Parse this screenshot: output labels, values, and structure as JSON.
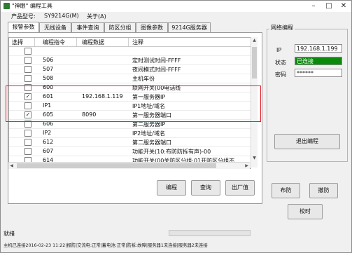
{
  "window": {
    "title": "\"神眼\" 编程工具",
    "min_icon": "minimize-icon",
    "max_icon": "maximize-icon",
    "close_icon": "close-icon"
  },
  "menu": {
    "product_label": "产品型号:",
    "product_model": "SY9214G(M)",
    "about": "关于(A)"
  },
  "tabs": [
    {
      "label": "报警参数",
      "active": true
    },
    {
      "label": "无线设备",
      "active": false
    },
    {
      "label": "事件查询",
      "active": false
    },
    {
      "label": "防区分组",
      "active": false
    },
    {
      "label": "图像参数",
      "active": false
    },
    {
      "label": "9214G服务器",
      "active": false
    }
  ],
  "table": {
    "headers": [
      "选择",
      "编程指令",
      "编程数据",
      "注释"
    ],
    "rows": [
      {
        "checked": false,
        "cmd": "",
        "data": "",
        "note": ""
      },
      {
        "checked": false,
        "cmd": "506",
        "data": "",
        "note": "定时测试时间-FFFF"
      },
      {
        "checked": false,
        "cmd": "507",
        "data": "",
        "note": "夜间模式时间-FFFF"
      },
      {
        "checked": false,
        "cmd": "508",
        "data": "",
        "note": "主机年份"
      },
      {
        "checked": false,
        "cmd": "600",
        "data": "",
        "note": "联网开关(00电话线"
      },
      {
        "checked": true,
        "cmd": "601",
        "data": "192.168.1.119",
        "note": "第一服务器IP"
      },
      {
        "checked": false,
        "cmd": "IP1",
        "data": "",
        "note": "IP1地址/域名"
      },
      {
        "checked": true,
        "cmd": "605",
        "data": "8090",
        "note": "第一服务器端口"
      },
      {
        "checked": false,
        "cmd": "606",
        "data": "",
        "note": "第二服务器IP"
      },
      {
        "checked": false,
        "cmd": "IP2",
        "data": "",
        "note": "IP2地址/域名"
      },
      {
        "checked": false,
        "cmd": "612",
        "data": "",
        "note": "第二服务器端口"
      },
      {
        "checked": false,
        "cmd": "607",
        "data": "",
        "note": "功能开关(10:布防防拆有声)-00"
      },
      {
        "checked": false,
        "cmd": "614",
        "data": "",
        "note": "功能开关(00关防区分组;01开防区分组不"
      }
    ]
  },
  "buttons": {
    "program": "编程",
    "query": "查询",
    "factory": "出厂值",
    "exit_program": "退出编程",
    "arm": "布防",
    "disarm": "撤防",
    "sync_time": "校时"
  },
  "network": {
    "title": "网络编程",
    "ip_label": "IP",
    "ip_value": "192.168.1.199",
    "status_label": "状态",
    "status_value": "已连接",
    "password_label": "密码",
    "password_value": "******"
  },
  "status": {
    "ready": "就绪",
    "line": "主机已连接2016-02-23 11:22|报防|交流电:正常|蓄电池:正常|防拆:故障|服务器1未连接|服务器2未连接"
  }
}
